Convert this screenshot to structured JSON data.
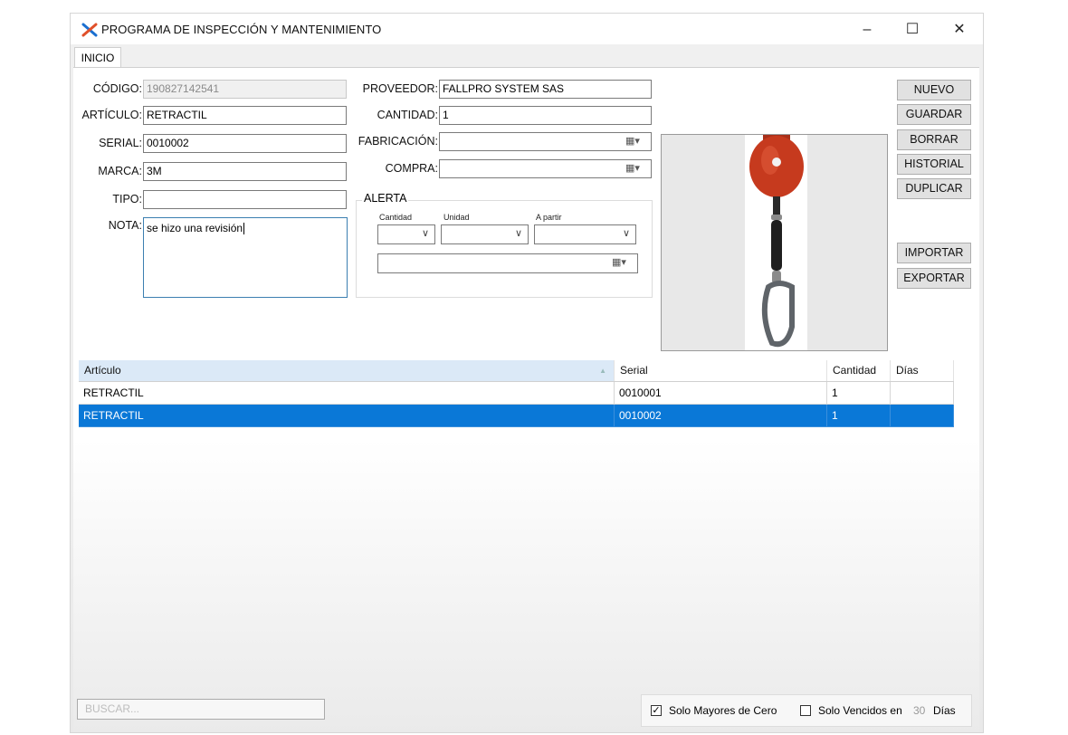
{
  "window": {
    "title": "PROGRAMA DE INSPECCIÓN Y MANTENIMIENTO",
    "controls": {
      "minimize": "–",
      "maximize": "☐",
      "close": "✕"
    }
  },
  "tabs": [
    {
      "label": "INICIO",
      "selected": true
    }
  ],
  "form_left": {
    "codigo_label": "CÓDIGO:",
    "codigo_value": "190827142541",
    "articulo_label": "ARTÍCULO:",
    "articulo_value": "RETRACTIL",
    "serial_label": "SERIAL:",
    "serial_value": "0010002",
    "marca_label": "MARCA:",
    "marca_value": "3M",
    "tipo_label": "TIPO:",
    "tipo_value": "",
    "nota_label": "NOTA:",
    "nota_value": "se hizo una revisión"
  },
  "form_right": {
    "proveedor_label": "PROVEEDOR:",
    "proveedor_value": "FALLPRO SYSTEM SAS",
    "cantidad_label": "CANTIDAD:",
    "cantidad_value": "1",
    "fabricacion_label": "FABRICACIÓN:",
    "fabricacion_value": "",
    "compra_label": "COMPRA:",
    "compra_value": ""
  },
  "alerta": {
    "title": "ALERTA",
    "cantidad_label": "Cantidad",
    "unidad_label": "Unidad",
    "apartir_label": "A partir",
    "cantidad_value": "",
    "unidad_value": "",
    "apartir_value": "",
    "fecha_value": ""
  },
  "buttons": {
    "nuevo": "NUEVO",
    "guardar": "GUARDAR",
    "borrar": "BORRAR",
    "historial": "HISTORIAL",
    "duplicar": "DUPLICAR",
    "importar": "IMPORTAR",
    "exportar": "EXPORTAR"
  },
  "image": {
    "subject": "retractable-fall-arrester",
    "colors": {
      "housing": "#c63a1e",
      "strap": "#1f1f1f",
      "hook": "#7a7f85"
    }
  },
  "table": {
    "columns": [
      "Artículo",
      "Serial",
      "Cantidad",
      "Días"
    ],
    "rows": [
      {
        "articulo": "RETRACTIL",
        "serial": "0010001",
        "cantidad": "1",
        "dias": "",
        "selected": false
      },
      {
        "articulo": "RETRACTIL",
        "serial": "0010002",
        "cantidad": "1",
        "dias": "",
        "selected": true
      }
    ]
  },
  "footer": {
    "search_placeholder": "BUSCAR...",
    "solo_mayores_label": "Solo Mayores de Cero",
    "solo_mayores_checked": true,
    "solo_vencidos_label": "Solo Vencidos en",
    "solo_vencidos_checked": false,
    "dias_value": "30",
    "dias_label": "Días"
  },
  "colors": {
    "selection": "#0a78d7",
    "header_tab": "#ffffff",
    "window_bg": "#f0f0f0"
  }
}
